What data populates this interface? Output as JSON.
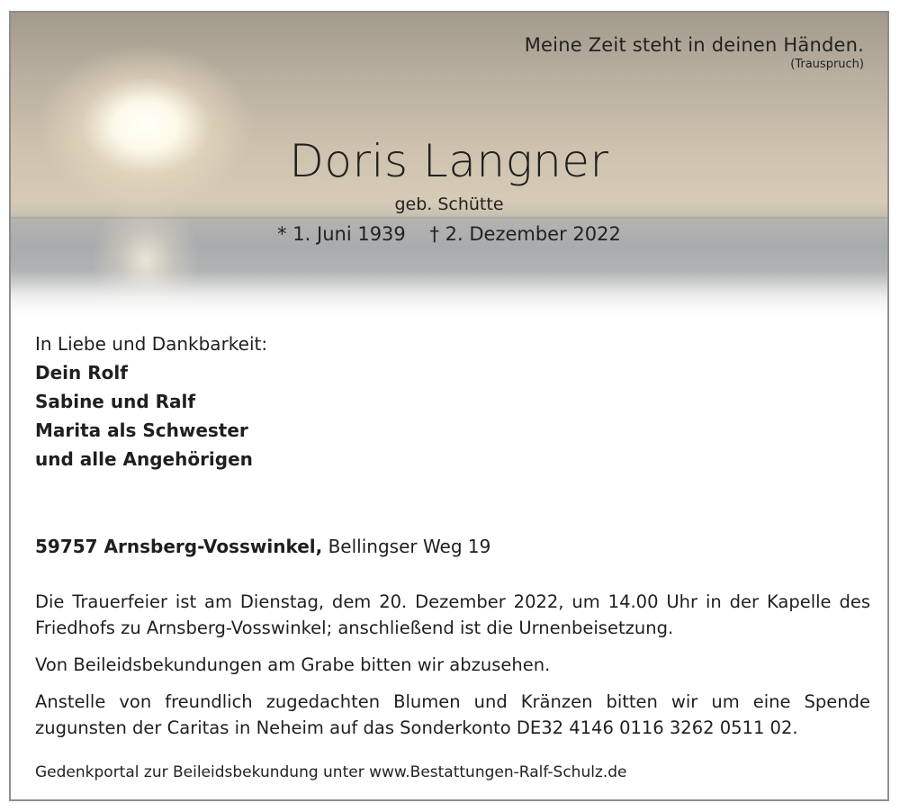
{
  "motto": {
    "text": "Meine Zeit steht in deinen Händen.",
    "source": "(Trauspruch)"
  },
  "deceased": {
    "name": "Doris Langner",
    "maiden_name": "geb. Schütte",
    "born": "* 1. Juni 1939",
    "died": "† 2. Dezember 2022"
  },
  "mourners": {
    "intro": "In Liebe und Dankbarkeit:",
    "names": [
      "Dein Rolf",
      "Sabine und Ralf",
      "Marita als Schwester",
      "und alle Angehörigen"
    ]
  },
  "address": {
    "city": "59757 Arnsberg-Vosswinkel,",
    "street": "Bellingser Weg 19"
  },
  "paragraphs": [
    "Die Trauerfeier ist am Dienstag, dem 20. Dezember 2022, um 14.00 Uhr in der Kapelle des Friedhofs zu Arnsberg-Vosswinkel; anschließend ist die Urnenbeisetzung.",
    "Von Beileidsbekundungen am Grabe bitten wir abzusehen.",
    "Anstelle von freundlich zugedachten Blumen und Kränzen bitten wir um eine Spende zugunsten der Caritas in Neheim auf das Sonderkonto DE32 4146 0116 3262 0511 02."
  ],
  "footer": "Gedenkportal zur Beileidsbekundung unter www.Bestattungen-Ralf-Schulz.de"
}
